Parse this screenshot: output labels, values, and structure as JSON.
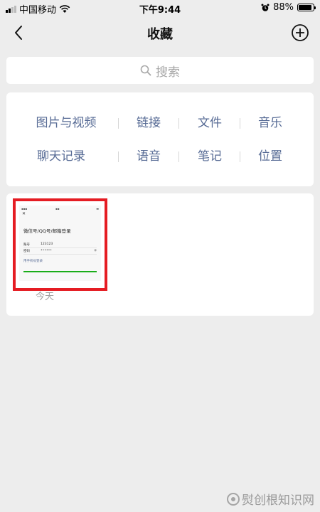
{
  "status_bar": {
    "carrier": "中国移动",
    "time": "下午9:44",
    "battery": "88%",
    "battery_level": 0.88
  },
  "nav": {
    "title": "收藏"
  },
  "search": {
    "placeholder": "搜索"
  },
  "categories": {
    "row1": [
      "图片与视频",
      "链接",
      "文件",
      "音乐"
    ],
    "row2": [
      "聊天记录",
      "语音",
      "笔记",
      "位置"
    ]
  },
  "favorites": [
    {
      "thumbnail": {
        "title": "微信号/QQ号/邮箱登录",
        "account_label": "账号",
        "account_value": "123123",
        "password_label": "密码",
        "password_value": "••••••",
        "link": "用手机号登录"
      },
      "date": "今天"
    }
  ],
  "watermark": {
    "text": "熨创根知识网"
  },
  "colors": {
    "accent": "#576b95",
    "highlight_border": "#e51c23",
    "background": "#ededed"
  }
}
